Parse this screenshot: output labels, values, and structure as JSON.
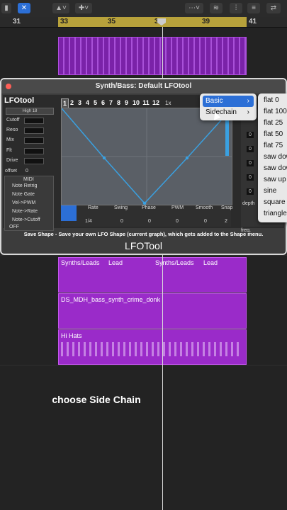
{
  "toolbar": {
    "items": [
      "pointer-tool",
      "plus-tool",
      "smart-controls",
      "waveform",
      "mixer",
      "tracks"
    ]
  },
  "ruler": {
    "bars": [
      "31",
      "33",
      "35",
      "37",
      "39",
      "41"
    ]
  },
  "plugin": {
    "window_title": "Synth/Bass: Default LFOtool",
    "logo": "LFOtool",
    "preset_label": "High 18",
    "controls": [
      "Cutoff",
      "Reso",
      "Mix",
      "Flt",
      "Drive"
    ],
    "offset_label": "offset",
    "offset_value": "0",
    "midi": {
      "title": "MIDI",
      "items": [
        "Note Retrig",
        "Note Gate",
        "Vel->PWM",
        "Note->Rate",
        "Note->Cutoff"
      ]
    },
    "midi_off": "OFF",
    "tabs": [
      "1",
      "2",
      "3",
      "4",
      "5",
      "6",
      "7",
      "8",
      "9",
      "10",
      "11",
      "12"
    ],
    "zoom": "1x",
    "knobs": [
      {
        "label": "Rate",
        "value": "1/4"
      },
      {
        "label": "Swing",
        "value": "0"
      },
      {
        "label": "Phase",
        "value": "0"
      },
      {
        "label": "PWM",
        "value": "0"
      },
      {
        "label": "Smooth",
        "value": "0"
      },
      {
        "label": "Snap",
        "value": "2"
      }
    ],
    "right_values": [
      "0",
      "0",
      "0",
      "0",
      "0",
      "0"
    ],
    "depth_label": "depth",
    "freq_label": "freq.",
    "tip": "Save Shape - Save your own LFO Shape (current graph), which gets added to the Shape menu.",
    "footer": "LFOTool",
    "accent": "#3aa0e0"
  },
  "menu": {
    "items": [
      {
        "label": "Basic",
        "selected": true
      },
      {
        "label": "Sidechain",
        "selected": false
      }
    ],
    "submenu": [
      "flat 0",
      "flat 100",
      "flat 25",
      "flat 50",
      "flat 75",
      "saw down",
      "saw down",
      "saw up",
      "sine",
      "square",
      "triangle"
    ]
  },
  "tracks": {
    "lane1": [
      "Synths/Leads",
      "Lead",
      "Synths/Leads",
      "Lead"
    ],
    "lane2": "DS_MDH_bass_synth_crime_donk",
    "lane3": "Hi Hats"
  },
  "caption": "choose Side Chain"
}
